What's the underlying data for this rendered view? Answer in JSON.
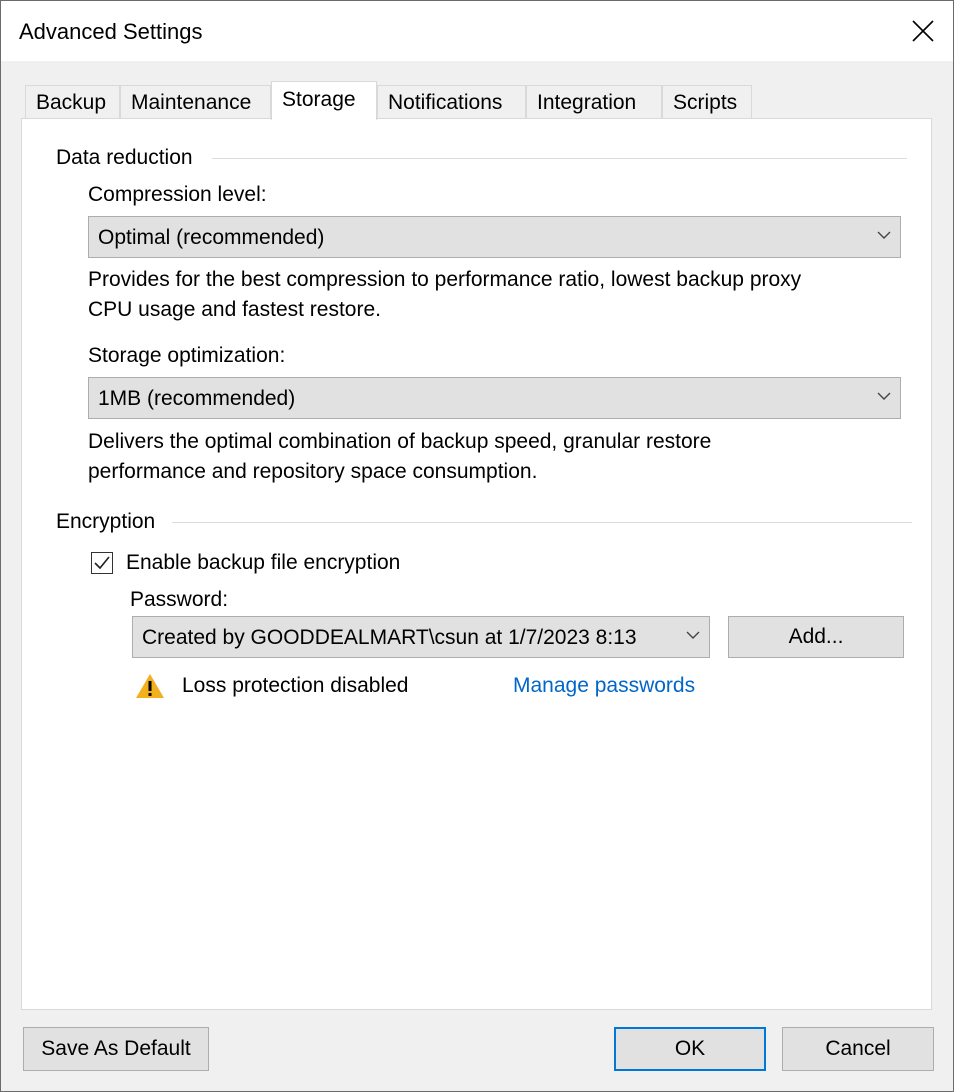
{
  "window": {
    "title": "Advanced Settings",
    "close_label": "✕"
  },
  "tabs": [
    {
      "label": "Backup",
      "active": false
    },
    {
      "label": "Maintenance",
      "active": false
    },
    {
      "label": "Storage",
      "active": true
    },
    {
      "label": "Notifications",
      "active": false
    },
    {
      "label": "Integration",
      "active": false
    },
    {
      "label": "Scripts",
      "active": false
    }
  ],
  "data_reduction": {
    "group_label": "Data reduction",
    "compression_label": "Compression level:",
    "compression_value": "Optimal (recommended)",
    "compression_desc_1": "Provides for the best compression to performance ratio, lowest backup proxy",
    "compression_desc_2": "CPU usage and fastest restore.",
    "storage_opt_label": "Storage optimization:",
    "storage_opt_value": "1MB (recommended)",
    "storage_opt_desc_1": "Delivers the optimal combination of backup speed, granular restore",
    "storage_opt_desc_2": "performance and repository space consumption."
  },
  "encryption": {
    "group_label": "Encryption",
    "enable_label": "Enable backup file encryption",
    "enable_checked": true,
    "password_label": "Password:",
    "password_value": "Created by GOODDEALMART\\csun at 1/7/2023 8:13",
    "add_label": "Add...",
    "warning_text": "Loss protection disabled",
    "manage_link": "Manage passwords",
    "warning_color": "#f2b01e",
    "link_color": "#0066cc"
  },
  "footer": {
    "save_default_label": "Save As Default",
    "ok_label": "OK",
    "cancel_label": "Cancel"
  }
}
